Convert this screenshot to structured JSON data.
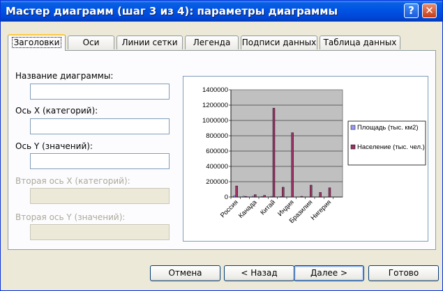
{
  "window": {
    "title": "Мастер диаграмм (шаг 3 из 4): параметры диаграммы",
    "help_label": "?",
    "close_label": "✕"
  },
  "tabs": [
    {
      "label": "Заголовки",
      "active": true
    },
    {
      "label": "Оси"
    },
    {
      "label": "Линии сетки"
    },
    {
      "label": "Легенда"
    },
    {
      "label": "Подписи данных"
    },
    {
      "label": "Таблица данных"
    }
  ],
  "fields": {
    "chart_title_label": "Название диаграммы:",
    "chart_title_value": "",
    "x_axis_label": "Ось X (категорий):",
    "x_axis_value": "",
    "y_axis_label": "Ось Y (значений):",
    "y_axis_value": "",
    "x2_axis_label": "Вторая ось X (категорий):",
    "x2_axis_value": "",
    "y2_axis_label": "Вторая ось Y (значений):",
    "y2_axis_value": ""
  },
  "buttons": {
    "cancel": "Отмена",
    "back": "< Назад",
    "next": "Далее >",
    "finish": "Готово"
  },
  "chart_data": {
    "type": "bar",
    "categories": [
      "Россия",
      "",
      "Канада",
      "",
      "Китай",
      "",
      "Индия",
      "",
      "Бразилия",
      "",
      "Нигерия",
      ""
    ],
    "tick_labels_shown": [
      "Россия",
      "Канада",
      "Китай",
      "Индия",
      "Бразилия",
      "Нигерия"
    ],
    "series": [
      {
        "name": "Площадь (тыс. км2)",
        "color": "#9999ff",
        "values": [
          17075,
          9976,
          9597,
          3288,
          8512,
          924,
          0,
          0,
          0,
          0,
          0,
          0
        ]
      },
      {
        "name": "Население (тыс. чел.)",
        "color": "#993366",
        "values": [
          145000,
          8000,
          31000,
          22000,
          1160000,
          128000,
          840000,
          9000,
          155000,
          60000,
          120000,
          0
        ]
      }
    ],
    "ylim": [
      0,
      1400000
    ],
    "yticks": [
      "1400000",
      "1200000",
      "1000000",
      "800000",
      "600000",
      "400000",
      "200000",
      "0"
    ],
    "plot_background": "#c0c0c0",
    "grid": true,
    "legend_position": "right"
  }
}
